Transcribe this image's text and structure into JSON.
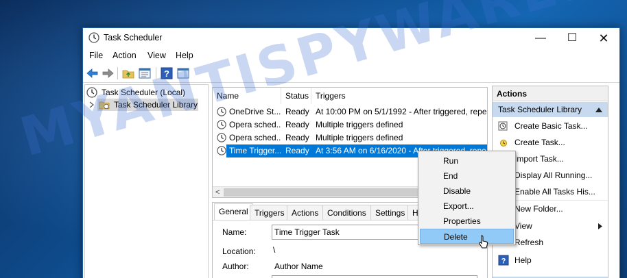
{
  "window": {
    "title": "Task Scheduler"
  },
  "menu": [
    "File",
    "Action",
    "View",
    "Help"
  ],
  "tree": {
    "root": "Task Scheduler (Local)",
    "library": "Task Scheduler Library"
  },
  "task_list": {
    "columns": [
      "Name",
      "Status",
      "Triggers"
    ],
    "rows": [
      {
        "name": "OneDrive St...",
        "status": "Ready",
        "triggers": "At 10:00 PM on 5/1/1992 - After triggered, repe"
      },
      {
        "name": "Opera sched...",
        "status": "Ready",
        "triggers": "Multiple triggers defined"
      },
      {
        "name": "Opera sched...",
        "status": "Ready",
        "triggers": "Multiple triggers defined"
      },
      {
        "name": "Time Trigger...",
        "status": "Ready",
        "triggers": "At 3:56 AM on 6/16/2020 - After triggered, repe"
      }
    ],
    "scroll_left": "<"
  },
  "detail": {
    "tabs": [
      "General",
      "Triggers",
      "Actions",
      "Conditions",
      "Settings",
      "H"
    ],
    "name_label": "Name:",
    "name_value": "Time Trigger Task",
    "location_label": "Location:",
    "location_value": "\\",
    "author_label": "Author:",
    "author_value": "Author Name"
  },
  "actions": {
    "header": "Actions",
    "section": "Task Scheduler Library",
    "items": [
      "Create Basic Task...",
      "Create Task...",
      "Import Task...",
      "Display All Running...",
      "Enable All Tasks His...",
      "New Folder...",
      "View",
      "Refresh",
      "Help"
    ]
  },
  "context_menu": [
    "Run",
    "End",
    "Disable",
    "Export...",
    "Properties",
    "Delete"
  ],
  "watermark": "MYANTISPYWARE.COM",
  "colors": {
    "selection": "#0078d7",
    "context_hover": "#91c9f7",
    "actions_section": "#c6d9ef",
    "desktop": "#0e4a8a"
  }
}
